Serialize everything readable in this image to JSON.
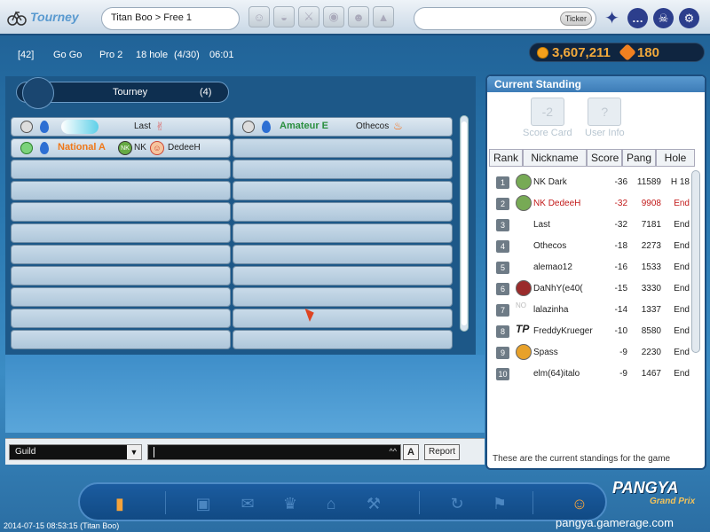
{
  "header": {
    "app_title": "Tourney",
    "breadcrumb": "Titan Boo > Free 1",
    "ticker_label": "Ticker",
    "right_icons": [
      "sparkle-icon",
      "chat-icon",
      "skull-icon",
      "gear-icon"
    ]
  },
  "infobar": {
    "room_id": "[42]",
    "mode": "Go Go",
    "level": "Pro 2",
    "holes": "18 hole",
    "progress": "(4/30)",
    "time": "06:01",
    "pang": "3,607,211",
    "cookies": "180",
    "accent_color": "#f2a93b"
  },
  "tourney": {
    "title": "Tourney",
    "count": "(4)"
  },
  "slots": [
    {
      "label": "",
      "name": "Last",
      "side": "left",
      "emblem": "hand"
    },
    {
      "label": "Amateur E",
      "name": "Othecos",
      "side": "right",
      "emblem": "flame"
    },
    {
      "label": "National A",
      "name": "NK",
      "name2": "DedeeH",
      "side": "left",
      "emblem": "face"
    }
  ],
  "standings": {
    "title": "Current Standing",
    "tools": [
      {
        "label": "Score Card",
        "badge": "-2"
      },
      {
        "label": "User Info",
        "badge": "?"
      }
    ],
    "columns": [
      "Rank",
      "Nickname",
      "Score",
      "Pang",
      "Hole"
    ],
    "rows": [
      {
        "rank": "1",
        "nick": "NK",
        "nick2": "Dark",
        "score": "-36",
        "pang": "11589",
        "hole": "H 18",
        "me": false
      },
      {
        "rank": "2",
        "nick": "NK",
        "nick2": "DedeeH",
        "score": "-32",
        "pang": "9908",
        "hole": "End",
        "me": true
      },
      {
        "rank": "3",
        "nick": "Last",
        "nick2": "",
        "score": "-32",
        "pang": "7181",
        "hole": "End",
        "me": false
      },
      {
        "rank": "4",
        "nick": "Othecos",
        "nick2": "",
        "score": "-18",
        "pang": "2273",
        "hole": "End",
        "me": false
      },
      {
        "rank": "5",
        "nick": "alemao12",
        "nick2": "",
        "score": "-16",
        "pang": "1533",
        "hole": "End",
        "me": false
      },
      {
        "rank": "6",
        "nick": "DaNhY(e40(",
        "nick2": "",
        "score": "-15",
        "pang": "3330",
        "hole": "End",
        "me": false
      },
      {
        "rank": "7",
        "nick": "lalazinha",
        "nick2": "",
        "score": "-14",
        "pang": "1337",
        "hole": "End",
        "me": false
      },
      {
        "rank": "8",
        "nick": "FreddyKrueger",
        "nick2": "",
        "score": "-10",
        "pang": "8580",
        "hole": "End",
        "me": false
      },
      {
        "rank": "9",
        "nick": "Spass",
        "nick2": "",
        "score": "-9",
        "pang": "2230",
        "hole": "End",
        "me": false
      },
      {
        "rank": "10",
        "nick": "elm(64)italo",
        "nick2": "",
        "score": "-9",
        "pang": "1467",
        "hole": "End",
        "me": false
      }
    ],
    "footer": "These are the current standings for the game"
  },
  "chat": {
    "channel": "Guild",
    "kbd": "^^",
    "a_button": "A",
    "report_button": "Report"
  },
  "bottom": {
    "brand": "PANGYA",
    "brand_sub": "Grand Prix",
    "site": "pangya.gamerage.com",
    "timestamp": "2014-07-15 08:53:15 (Titan Boo)"
  }
}
